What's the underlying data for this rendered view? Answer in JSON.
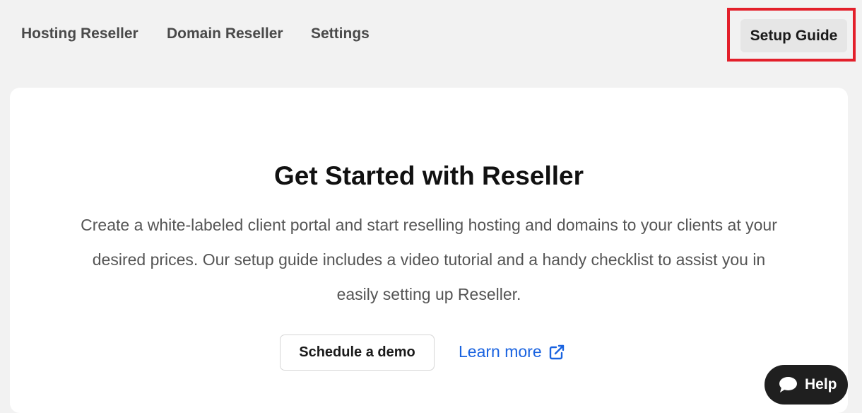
{
  "nav": {
    "items": [
      {
        "label": "Hosting Reseller"
      },
      {
        "label": "Domain Reseller"
      },
      {
        "label": "Settings"
      }
    ],
    "setup_guide_label": "Setup Guide"
  },
  "card": {
    "title": "Get Started with Reseller",
    "description": "Create a white-labeled client portal and start reselling hosting and domains to your clients at your desired prices. Our setup guide includes a video tutorial and a handy checklist to assist you in easily setting up Reseller.",
    "demo_button_label": "Schedule a demo",
    "learn_more_label": "Learn more",
    "learn_more_icon": "external-link-icon"
  },
  "help": {
    "label": "Help",
    "icon": "chat-bubble-icon"
  },
  "colors": {
    "highlight": "#e3202b",
    "link": "#1a63e0",
    "help_bg": "#1f1f1f",
    "page_bg": "#f2f2f2"
  }
}
